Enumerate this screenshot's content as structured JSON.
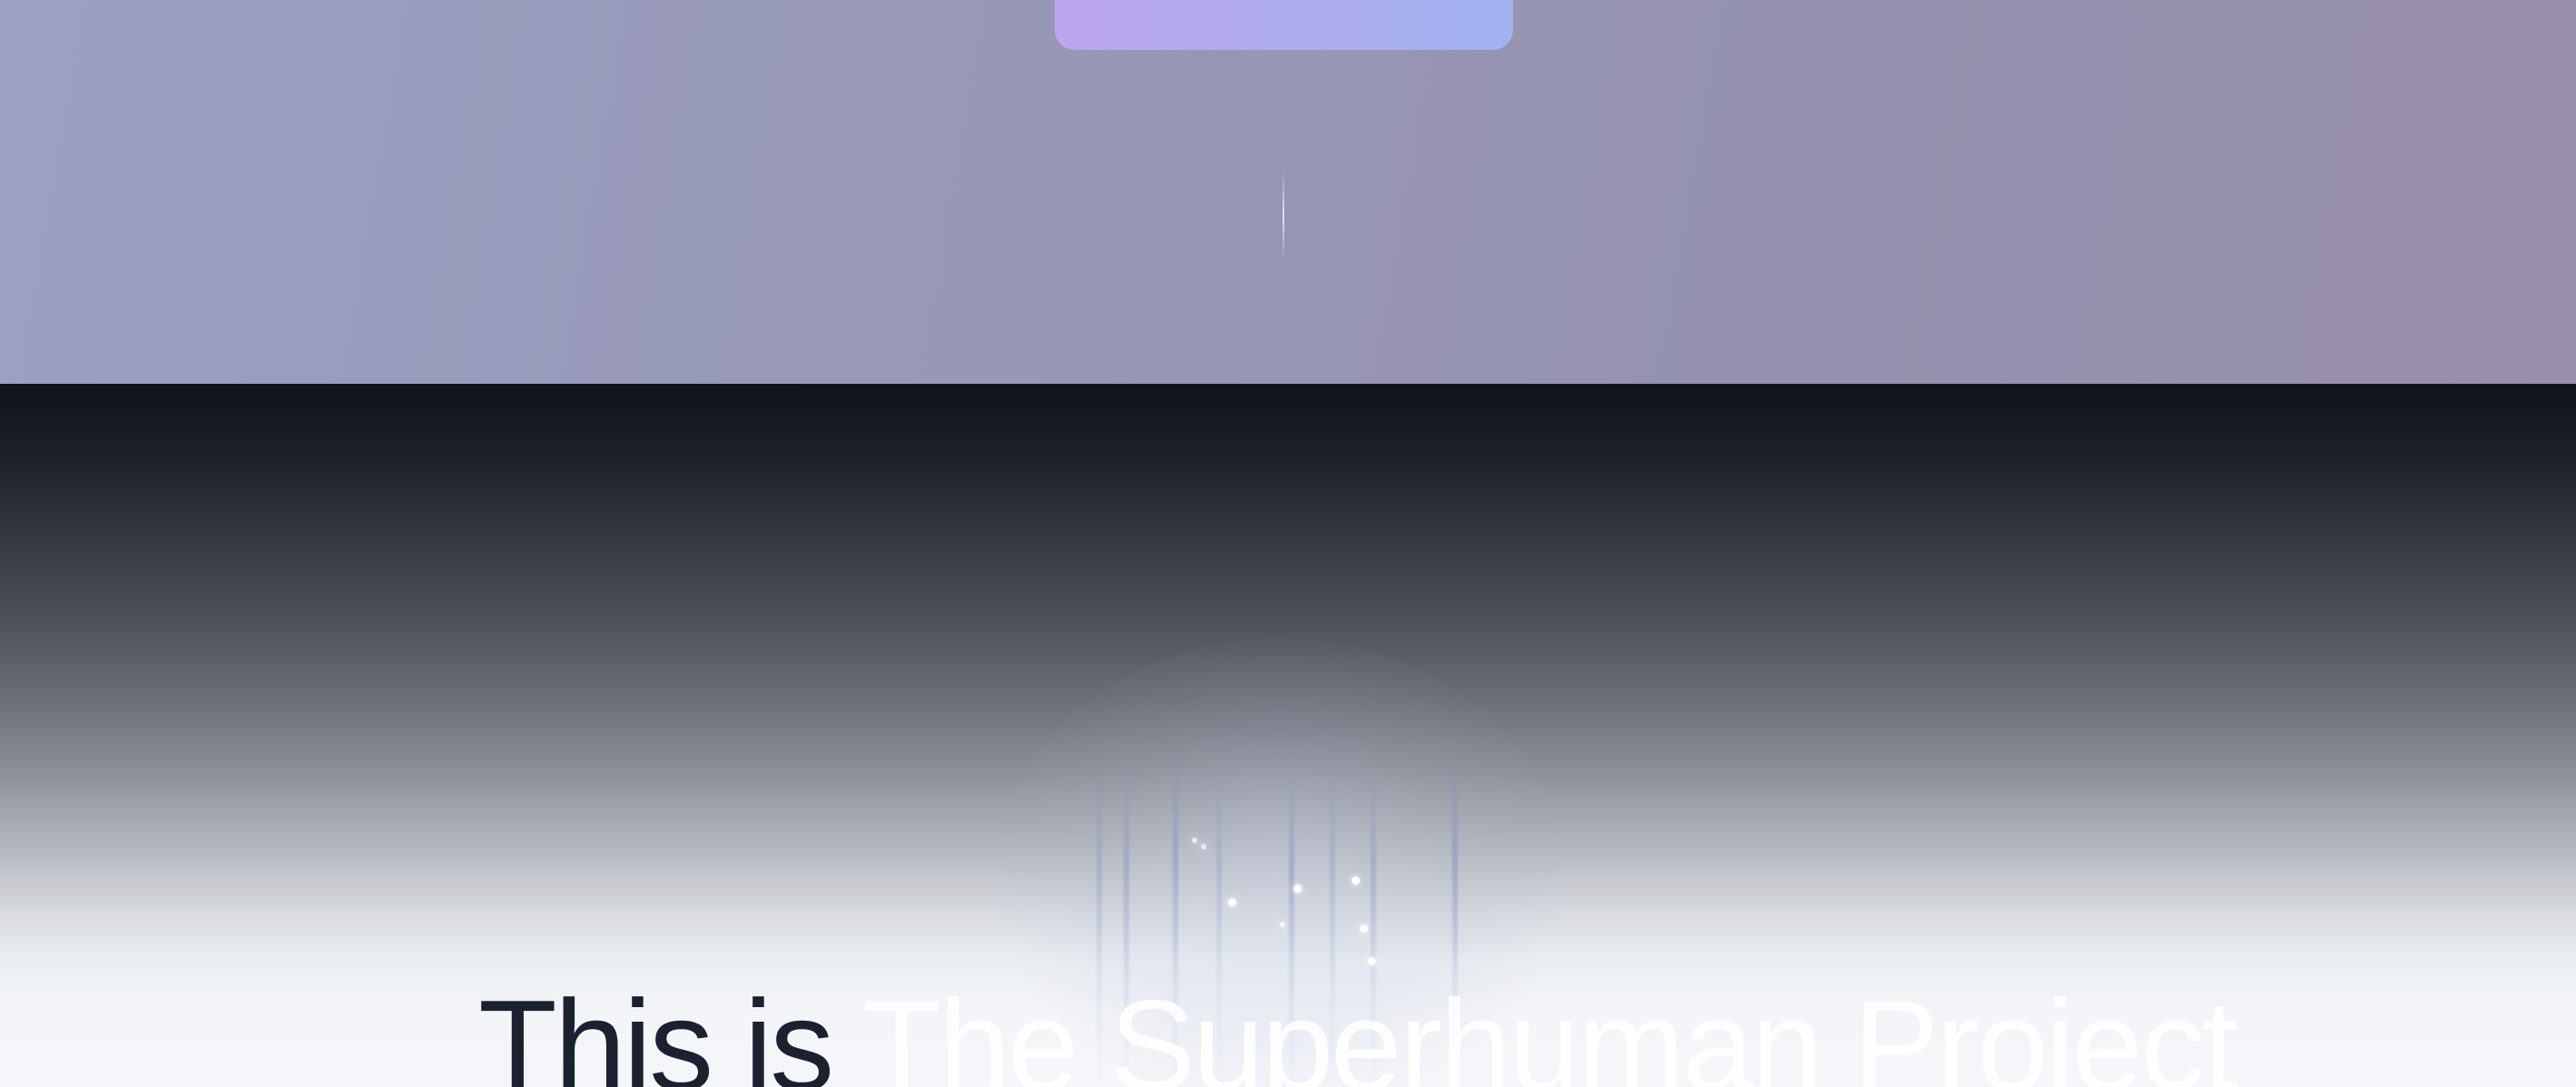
{
  "hero": {
    "headline_lead": "This is",
    "headline_brand": "The Superhuman Project"
  },
  "colors": {
    "top_background": "#9797b6",
    "card_gradient_start": "#bca6ee",
    "card_gradient_end": "#a0b2ef",
    "bottom_gradient_top": "#0f121c",
    "bottom_gradient_bottom": "#f4f6f9",
    "headline_dark": "#1c2130",
    "headline_light": "#ffffff"
  }
}
